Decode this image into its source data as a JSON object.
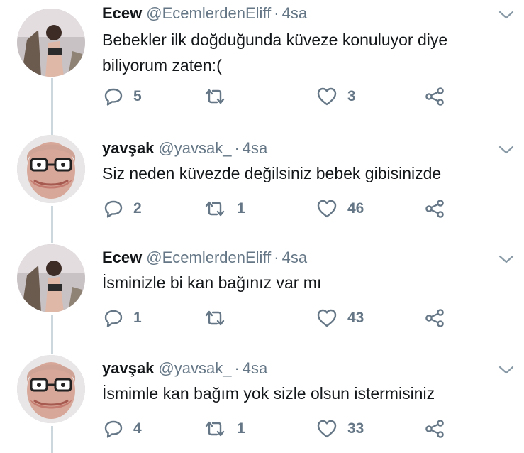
{
  "colors": {
    "text": "#14171a",
    "muted": "#657786",
    "thread_line": "#ccd6dd"
  },
  "icons": {
    "reply": "reply-icon",
    "retweet": "retweet-icon",
    "like": "heart-icon",
    "share": "share-icon",
    "menu": "chevron-down-icon"
  },
  "tweets": [
    {
      "name": "Ecew",
      "handle": "@EcemlerdenEliff",
      "dot": "·",
      "time": "4sa",
      "text": "Bebekler ilk doğduğunda küveze konuluyor diye biliyorum zaten:(",
      "replies": "5",
      "retweets": "",
      "likes": "3"
    },
    {
      "name": "yavşak",
      "handle": "@yavsak_",
      "dot": "·",
      "time": "4sa",
      "text": "Siz neden küvezde değilsiniz bebek gibisinizde",
      "replies": "2",
      "retweets": "1",
      "likes": "46"
    },
    {
      "name": "Ecew",
      "handle": "@EcemlerdenEliff",
      "dot": "·",
      "time": "4sa",
      "text": "İsminizle bi kan bağınız var mı",
      "replies": "1",
      "retweets": "",
      "likes": "43"
    },
    {
      "name": "yavşak",
      "handle": "@yavsak_",
      "dot": "·",
      "time": "4sa",
      "text": "İsmimle kan bağım yok sizle olsun istermisiniz",
      "replies": "4",
      "retweets": "1",
      "likes": "33"
    }
  ]
}
